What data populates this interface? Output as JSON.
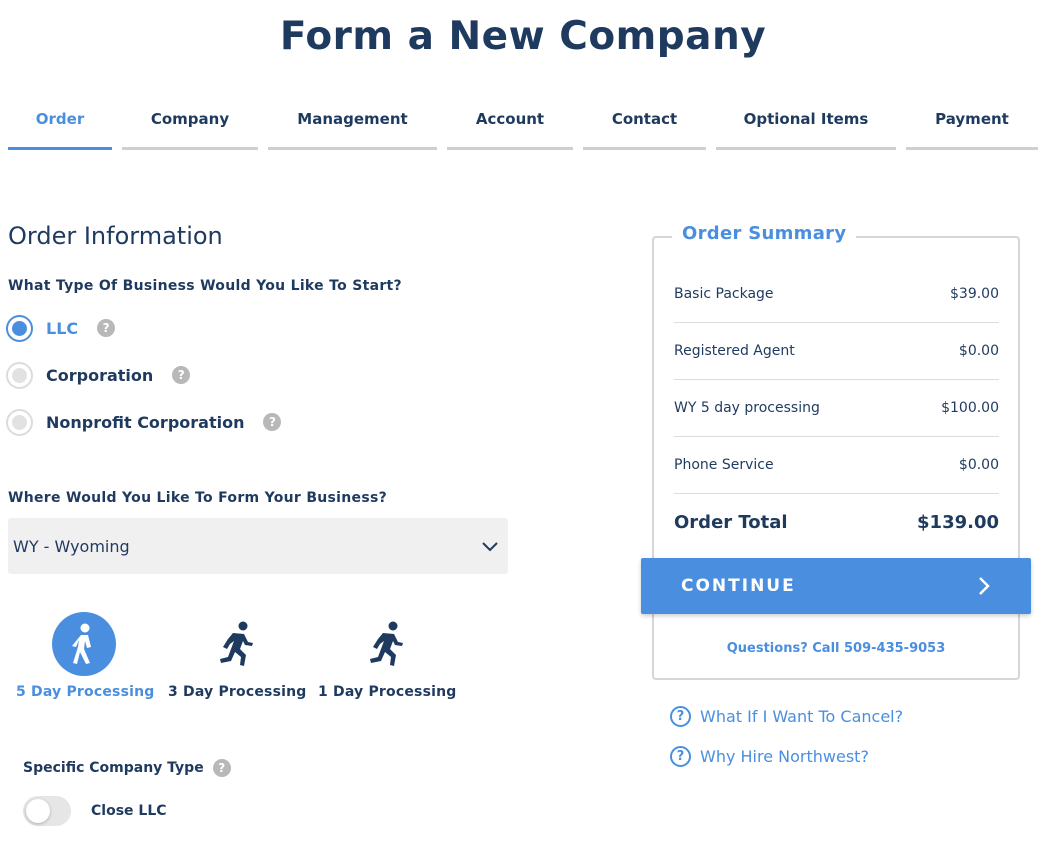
{
  "page": {
    "title": "Form a New Company"
  },
  "tabs": [
    {
      "label": "Order",
      "active": true
    },
    {
      "label": "Company"
    },
    {
      "label": "Management"
    },
    {
      "label": "Account"
    },
    {
      "label": "Contact"
    },
    {
      "label": "Optional Items"
    },
    {
      "label": "Payment"
    }
  ],
  "order_info": {
    "title": "Order Information",
    "business_type_question": "What Type Of Business Would You Like To Start?",
    "business_types": [
      {
        "label": "LLC",
        "selected": true,
        "help_icon": "question-circle-icon"
      },
      {
        "label": "Corporation",
        "help_icon": "question-circle-icon"
      },
      {
        "label": "Nonprofit Corporation",
        "help_icon": "question-circle-icon"
      }
    ],
    "state_question": "Where Would You Like To Form Your Business?",
    "state_selected": "WY - Wyoming",
    "processing_options": [
      {
        "label": "5 Day Processing",
        "icon": "walking-person-icon",
        "selected": true
      },
      {
        "label": "3 Day Processing",
        "icon": "running-person-icon"
      },
      {
        "label": "1 Day Processing",
        "icon": "running-person-icon"
      }
    ],
    "specific_type_label": "Specific Company Type",
    "close_llc_label": "Close LLC",
    "close_llc_on": false
  },
  "summary": {
    "title": "Order Summary",
    "items": [
      {
        "name": "Basic Package",
        "price": "$39.00"
      },
      {
        "name": "Registered Agent",
        "price": "$0.00"
      },
      {
        "name": "WY 5 day processing",
        "price": "$100.00"
      },
      {
        "name": "Phone Service",
        "price": "$0.00"
      }
    ],
    "total_label": "Order Total",
    "total_value": "$139.00",
    "continue_label": "CONTINUE",
    "phone_text": "Questions? Call 509-435-9053"
  },
  "links": [
    {
      "label": "What If I Want To Cancel?"
    },
    {
      "label": "Why Hire Northwest?"
    }
  ],
  "colors": {
    "accent": "#4a8fdf",
    "navy": "#1f3a5f",
    "muted": "#cfcfcf"
  }
}
